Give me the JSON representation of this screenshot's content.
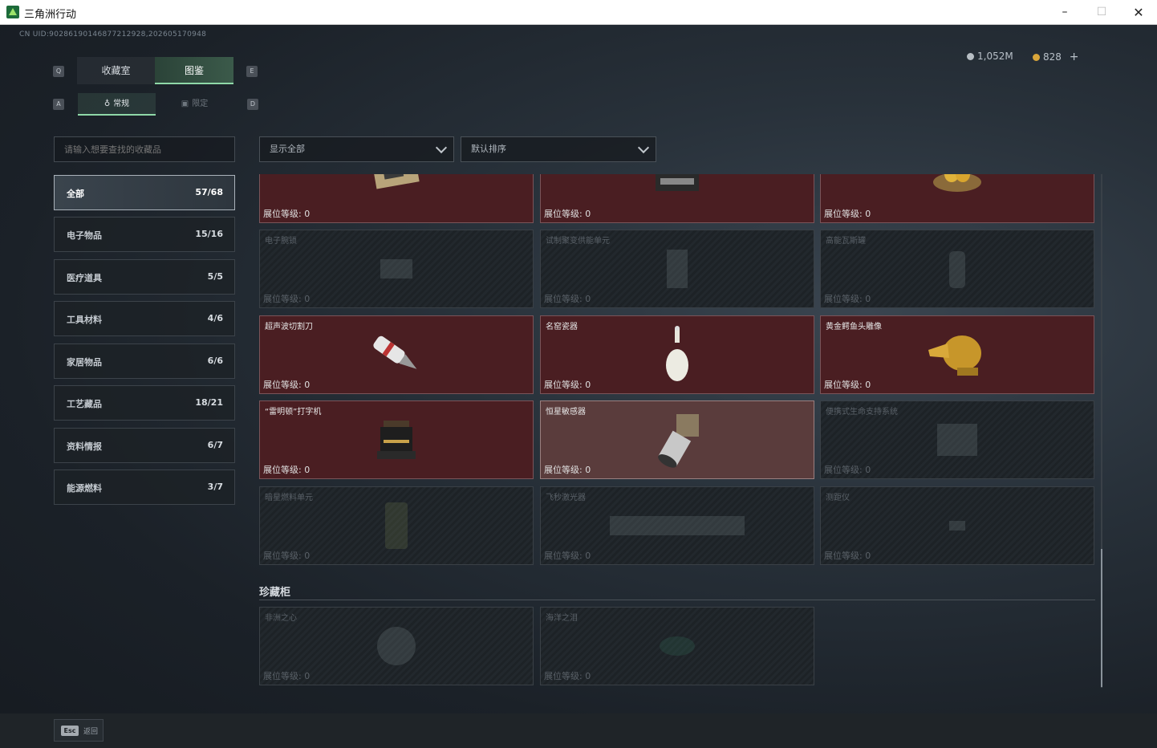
{
  "window": {
    "title": "三角洲行动",
    "minimize": "–",
    "maximize": "☐",
    "close": "✕"
  },
  "uid": "CN UID:90286190146877212928,202605170948",
  "currency": {
    "silver": "1,052M",
    "gold": "828",
    "add": "+"
  },
  "tabs": [
    {
      "key": "Q",
      "label": "收藏室"
    },
    {
      "label": "图鉴"
    }
  ],
  "tab_right_key": "E",
  "subtabs": [
    {
      "key": "A",
      "label": "常规"
    },
    {
      "label": "限定"
    }
  ],
  "subtab_right_key": "D",
  "search": {
    "placeholder": "请输入想要查找的收藏品"
  },
  "filters": {
    "show": "显示全部",
    "sort": "默认排序"
  },
  "categories": [
    {
      "label": "全部",
      "count": "57/68"
    },
    {
      "label": "电子物品",
      "count": "15/16"
    },
    {
      "label": "医疗道具",
      "count": "5/5"
    },
    {
      "label": "工具材料",
      "count": "4/6"
    },
    {
      "label": "家居物品",
      "count": "6/6"
    },
    {
      "label": "工艺藏品",
      "count": "18/21"
    },
    {
      "label": "资料情报",
      "count": "6/7"
    },
    {
      "label": "能源燃料",
      "count": "3/7"
    }
  ],
  "level_label": "展位等级:",
  "level_value": "0",
  "items": [
    {
      "name": "",
      "state": "owned",
      "icon": "circuit-board-icon"
    },
    {
      "name": "",
      "state": "owned",
      "icon": "tape-recorder-icon"
    },
    {
      "name": "",
      "state": "owned",
      "icon": "golden-eggs-nest-icon"
    },
    {
      "name": "电子腕锁",
      "state": "locked",
      "icon": "electronic-lock-icon"
    },
    {
      "name": "试制聚变供能单元",
      "state": "locked",
      "icon": "fusion-unit-icon"
    },
    {
      "name": "高能瓦斯罐",
      "state": "locked",
      "icon": "gas-canister-icon"
    },
    {
      "name": "超声波切割刀",
      "state": "owned",
      "icon": "ultrasonic-cutter-icon"
    },
    {
      "name": "名窑瓷器",
      "state": "owned",
      "icon": "porcelain-vase-icon"
    },
    {
      "name": "黄金鳄鱼头雕像",
      "state": "owned",
      "icon": "golden-crocodile-icon"
    },
    {
      "name": "“雷明顿”打字机",
      "state": "owned",
      "icon": "typewriter-icon"
    },
    {
      "name": "恒星敏感器",
      "state": "owned-light",
      "icon": "star-sensor-icon"
    },
    {
      "name": "便携式生命支持系统",
      "state": "locked",
      "icon": "life-support-icon"
    },
    {
      "name": "暗星燃料单元",
      "state": "locked",
      "icon": "fuel-cell-icon"
    },
    {
      "name": "飞秒激光器",
      "state": "locked",
      "icon": "laser-icon"
    },
    {
      "name": "测距仪",
      "state": "locked",
      "icon": "rangefinder-icon"
    }
  ],
  "section_title": "珍藏柜",
  "treasures": [
    {
      "name": "非洲之心",
      "state": "locked",
      "icon": "diamond-icon"
    },
    {
      "name": "海洋之泪",
      "state": "locked",
      "icon": "gem-icon"
    }
  ],
  "esc": {
    "key": "Esc",
    "label": "返回"
  }
}
